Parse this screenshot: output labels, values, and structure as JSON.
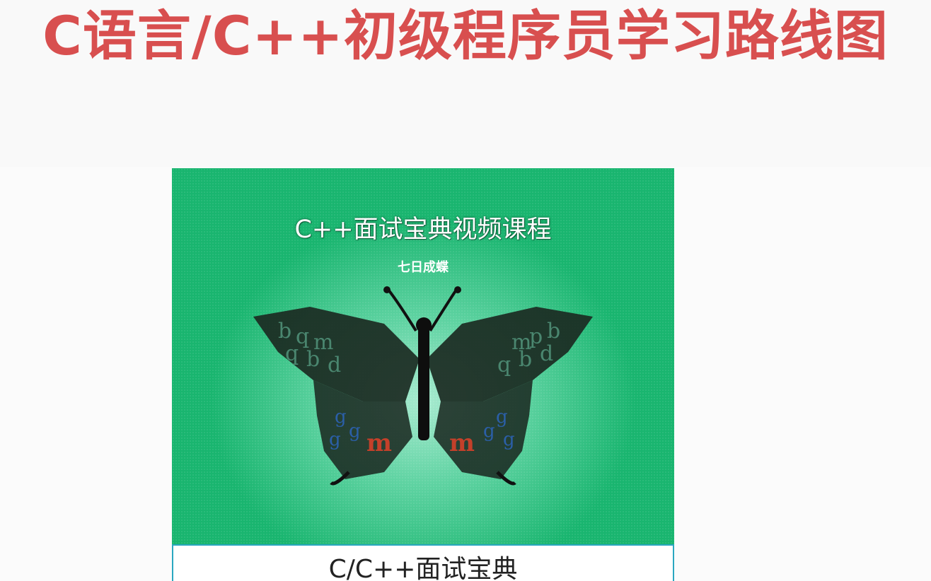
{
  "slide": {
    "title": "C语言/C++初级程序员学习路线图"
  },
  "cover": {
    "title": "C++面试宝典视频课程",
    "subtitle": "七日成蝶"
  },
  "caption": {
    "text": "C/C++面试宝典"
  },
  "colors": {
    "title_red": "#d84f4f",
    "cover_green": "#19b56f",
    "cover_glow": "#a8ead0",
    "caption_border": "#2aa7c0"
  }
}
